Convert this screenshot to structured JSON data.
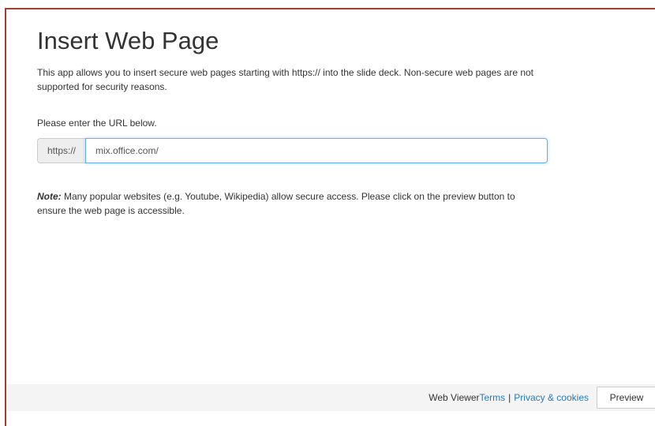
{
  "page": {
    "title": "Insert Web Page",
    "description": "This app allows you to insert secure web pages starting with https:// into the slide deck. Non-secure web pages are not supported for security reasons.",
    "prompt": "Please enter the URL below."
  },
  "url_field": {
    "prefix": "https://",
    "value": "mix.office.com/"
  },
  "note": {
    "label": "Note:",
    "text": " Many popular websites (e.g. Youtube, Wikipedia) allow secure access. Please click on the preview button to ensure the web page is accessible."
  },
  "footer": {
    "app_name": "Web Viewer ",
    "terms_link": "Terms",
    "separator": "|",
    "privacy_link": "Privacy & cookies",
    "preview_button": "Preview"
  },
  "colors": {
    "frame_border": "#a0412f",
    "link": "#2a7ab8",
    "input_focus": "#66afe9"
  }
}
